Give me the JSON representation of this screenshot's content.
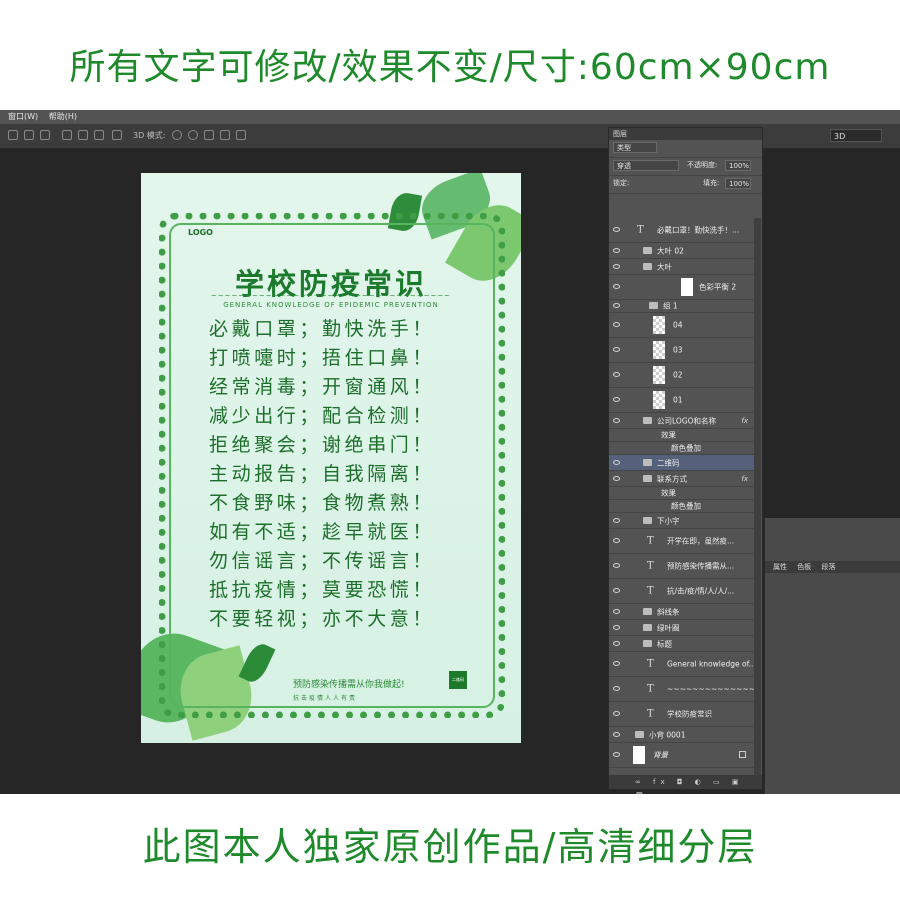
{
  "banners": {
    "top": "所有文字可修改/效果不变/尺寸:60cm×90cm",
    "bottom": "此图本人独家原创作品/高清细分层"
  },
  "menubar": {
    "window": "窗口(W)",
    "help": "帮助(H)"
  },
  "optionsbar": {
    "mode_label": "3D 模式:",
    "workspace": "3D"
  },
  "poster": {
    "logo": "LOGO",
    "title": "学校防疫常识",
    "tilde": "~~~~~~~~~~~~~~~~~~~~~~~~~~~~~~~~~~~",
    "subtitle": "GENERAL KNOWLEDGE OF EPIDEMIC PREVENTION",
    "rhymes": [
      "必戴口罩；勤快洗手！",
      "打喷嚏时；捂住口鼻！",
      "经常消毒；开窗通风！",
      "减少出行；配合检测！",
      "拒绝聚会；谢绝串门！",
      "主动报告；自我隔离！",
      "不食野味；食物煮熟！",
      "如有不适；趁早就医！",
      "勿信谣言；不传谣言！",
      "抵抗疫情；莫要恐慌！",
      "不要轻视；亦不大意！"
    ],
    "prevent": "预防感染传播需从你我做起!",
    "fight": "抗击疫情人人有责",
    "qr_label": "二维码"
  },
  "layers_panel": {
    "title": "图层",
    "filter": "类型",
    "blend": "穿透",
    "opacity_label": "不透明度:",
    "opacity": "100%",
    "lock_label": "锁定:",
    "fill_label": "填充:",
    "fill": "100%",
    "layers": [
      {
        "name": "必戴口罩！勤快洗手！...",
        "kind": "text"
      },
      {
        "name": "大叶 02",
        "kind": "folder"
      },
      {
        "name": "大叶",
        "kind": "folder-open"
      },
      {
        "name": "色彩平衡 2",
        "kind": "adjust"
      },
      {
        "name": "组 1",
        "kind": "folder-open"
      },
      {
        "name": "04",
        "kind": "thumb"
      },
      {
        "name": "03",
        "kind": "thumb"
      },
      {
        "name": "02",
        "kind": "thumb"
      },
      {
        "name": "01",
        "kind": "thumb"
      },
      {
        "name": "公司LOGO和名称",
        "kind": "folder-fx"
      },
      {
        "name": "效果",
        "kind": "effect"
      },
      {
        "name": "颜色叠加",
        "kind": "effect-sub"
      },
      {
        "name": "二维码",
        "kind": "folder-sel"
      },
      {
        "name": "联系方式",
        "kind": "folder-fx"
      },
      {
        "name": "效果",
        "kind": "effect"
      },
      {
        "name": "颜色叠加",
        "kind": "effect-sub"
      },
      {
        "name": "下小字",
        "kind": "folder-open"
      },
      {
        "name": "开学在即，虽然疫...",
        "kind": "text"
      },
      {
        "name": "预防感染传播需从...",
        "kind": "text"
      },
      {
        "name": "抗/击/疫/情/人/人/...",
        "kind": "text"
      },
      {
        "name": "斜线条",
        "kind": "folder"
      },
      {
        "name": "绿叶圈",
        "kind": "folder"
      },
      {
        "name": "标题",
        "kind": "folder-open"
      },
      {
        "name": "General knowledge of...",
        "kind": "text"
      },
      {
        "name": "~~~~~~~~~~~~~~~~",
        "kind": "text"
      },
      {
        "name": "学校防疫常识",
        "kind": "text"
      },
      {
        "name": "小背 0001",
        "kind": "folder"
      },
      {
        "name": "背景",
        "kind": "bg"
      }
    ]
  },
  "side_panel": {
    "tabs": [
      "属性",
      "色板",
      "段落"
    ]
  }
}
